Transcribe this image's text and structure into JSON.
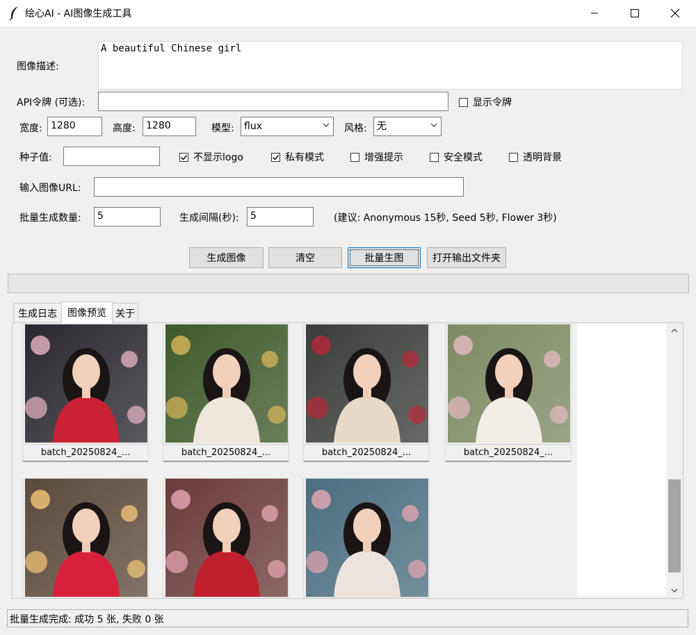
{
  "window": {
    "title": "绘心AI - AI图像生成工具",
    "icon": "feather-icon"
  },
  "form": {
    "prompt_label": "图像描述:",
    "prompt_value": "A beautiful Chinese girl",
    "api_label": "API令牌 (可选):",
    "api_value": "",
    "show_token_label": "显示令牌",
    "width_label": "宽度:",
    "width_value": "1280",
    "height_label": "高度:",
    "height_value": "1280",
    "model_label": "模型:",
    "model_value": "flux",
    "style_label": "风格:",
    "style_value": "无",
    "seed_label": "种子值:",
    "seed_value": "",
    "options": [
      {
        "label": "不显示logo",
        "checked": true
      },
      {
        "label": "私有模式",
        "checked": true
      },
      {
        "label": "增强提示",
        "checked": false
      },
      {
        "label": "安全模式",
        "checked": false
      },
      {
        "label": "透明背景",
        "checked": false
      }
    ],
    "url_label": "输入图像URL:",
    "url_value": "",
    "batch_count_label": "批量生成数量:",
    "batch_count_value": "5",
    "interval_label": "生成间隔(秒):",
    "interval_value": "5",
    "hint": "(建议: Anonymous 15秒, Seed 5秒, Flower 3秒)"
  },
  "buttons": {
    "generate": "生成图像",
    "clear": "清空",
    "batch": "批量生图",
    "open_folder": "打开输出文件夹"
  },
  "progress": 0,
  "tabs": [
    {
      "label": "生成日志",
      "active": false
    },
    {
      "label": "图像预览",
      "active": true
    },
    {
      "label": "关于",
      "active": false
    }
  ],
  "gallery": {
    "items": [
      {
        "caption": "batch_20250824_...",
        "palette": [
          "#2a2730",
          "#c82234",
          "#e9b7c4"
        ]
      },
      {
        "caption": "batch_20250824_...",
        "palette": [
          "#3e5a2a",
          "#efe7dc",
          "#d8b65a"
        ]
      },
      {
        "caption": "batch_20250824_...",
        "palette": [
          "#3a3d3a",
          "#e8d9c9",
          "#b8283a"
        ]
      },
      {
        "caption": "batch_20250824_...",
        "palette": [
          "#7e8a64",
          "#f3ede8",
          "#e7b9c4"
        ]
      },
      {
        "caption": "",
        "palette": [
          "#5c4a3a",
          "#d8203c",
          "#f4c878"
        ]
      },
      {
        "caption": "",
        "palette": [
          "#6a3b38",
          "#c01f2e",
          "#e9a8b6"
        ]
      },
      {
        "caption": "",
        "palette": [
          "#4b6e80",
          "#ece4dc",
          "#e7a7b4"
        ]
      }
    ]
  },
  "status": "批量生成完成: 成功 5 张, 失败 0 张"
}
